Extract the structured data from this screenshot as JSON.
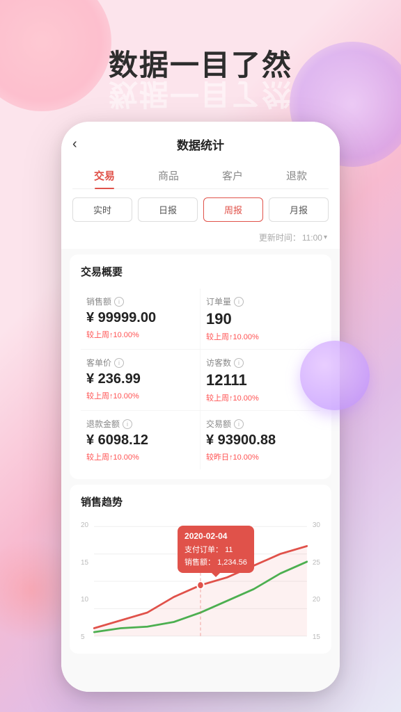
{
  "background": {
    "title": "数据一目了然"
  },
  "header": {
    "back_label": "‹",
    "title": "数据统计"
  },
  "tabs": [
    {
      "label": "交易",
      "active": true
    },
    {
      "label": "商品",
      "active": false
    },
    {
      "label": "客户",
      "active": false
    },
    {
      "label": "退款",
      "active": false
    }
  ],
  "period_buttons": [
    {
      "label": "实时",
      "active": false
    },
    {
      "label": "日报",
      "active": false
    },
    {
      "label": "周报",
      "active": true
    },
    {
      "label": "月报",
      "active": false
    }
  ],
  "update_label": "更新时间：",
  "update_time": "11:00",
  "overview_title": "交易概要",
  "metrics": [
    {
      "label": "销售额",
      "value": "¥ 99999.00",
      "change": "较上周↑10.00%"
    },
    {
      "label": "订单量",
      "value": "190",
      "change": "较上周↑10.00%"
    },
    {
      "label": "客单价",
      "value": "¥ 236.99",
      "change": "较上周↑10.00%"
    },
    {
      "label": "访客数",
      "value": "12111",
      "change": "较上周↑10.00%"
    },
    {
      "label": "退款金额",
      "value": "¥ 6098.12",
      "change": "较上周↑10.00%"
    },
    {
      "label": "交易额",
      "value": "¥ 93900.88",
      "change": "较昨日↑10.00%"
    }
  ],
  "trend_title": "销售趋势",
  "chart": {
    "y_axis_left": [
      "20",
      "15",
      "10",
      "5"
    ],
    "y_axis_right": [
      "30",
      "25",
      "20",
      "15"
    ],
    "tooltip": {
      "date": "2020-02-04",
      "order_label": "支付订单：",
      "order_value": "11",
      "sales_label": "销售额：",
      "sales_value": "1,234.56"
    }
  }
}
